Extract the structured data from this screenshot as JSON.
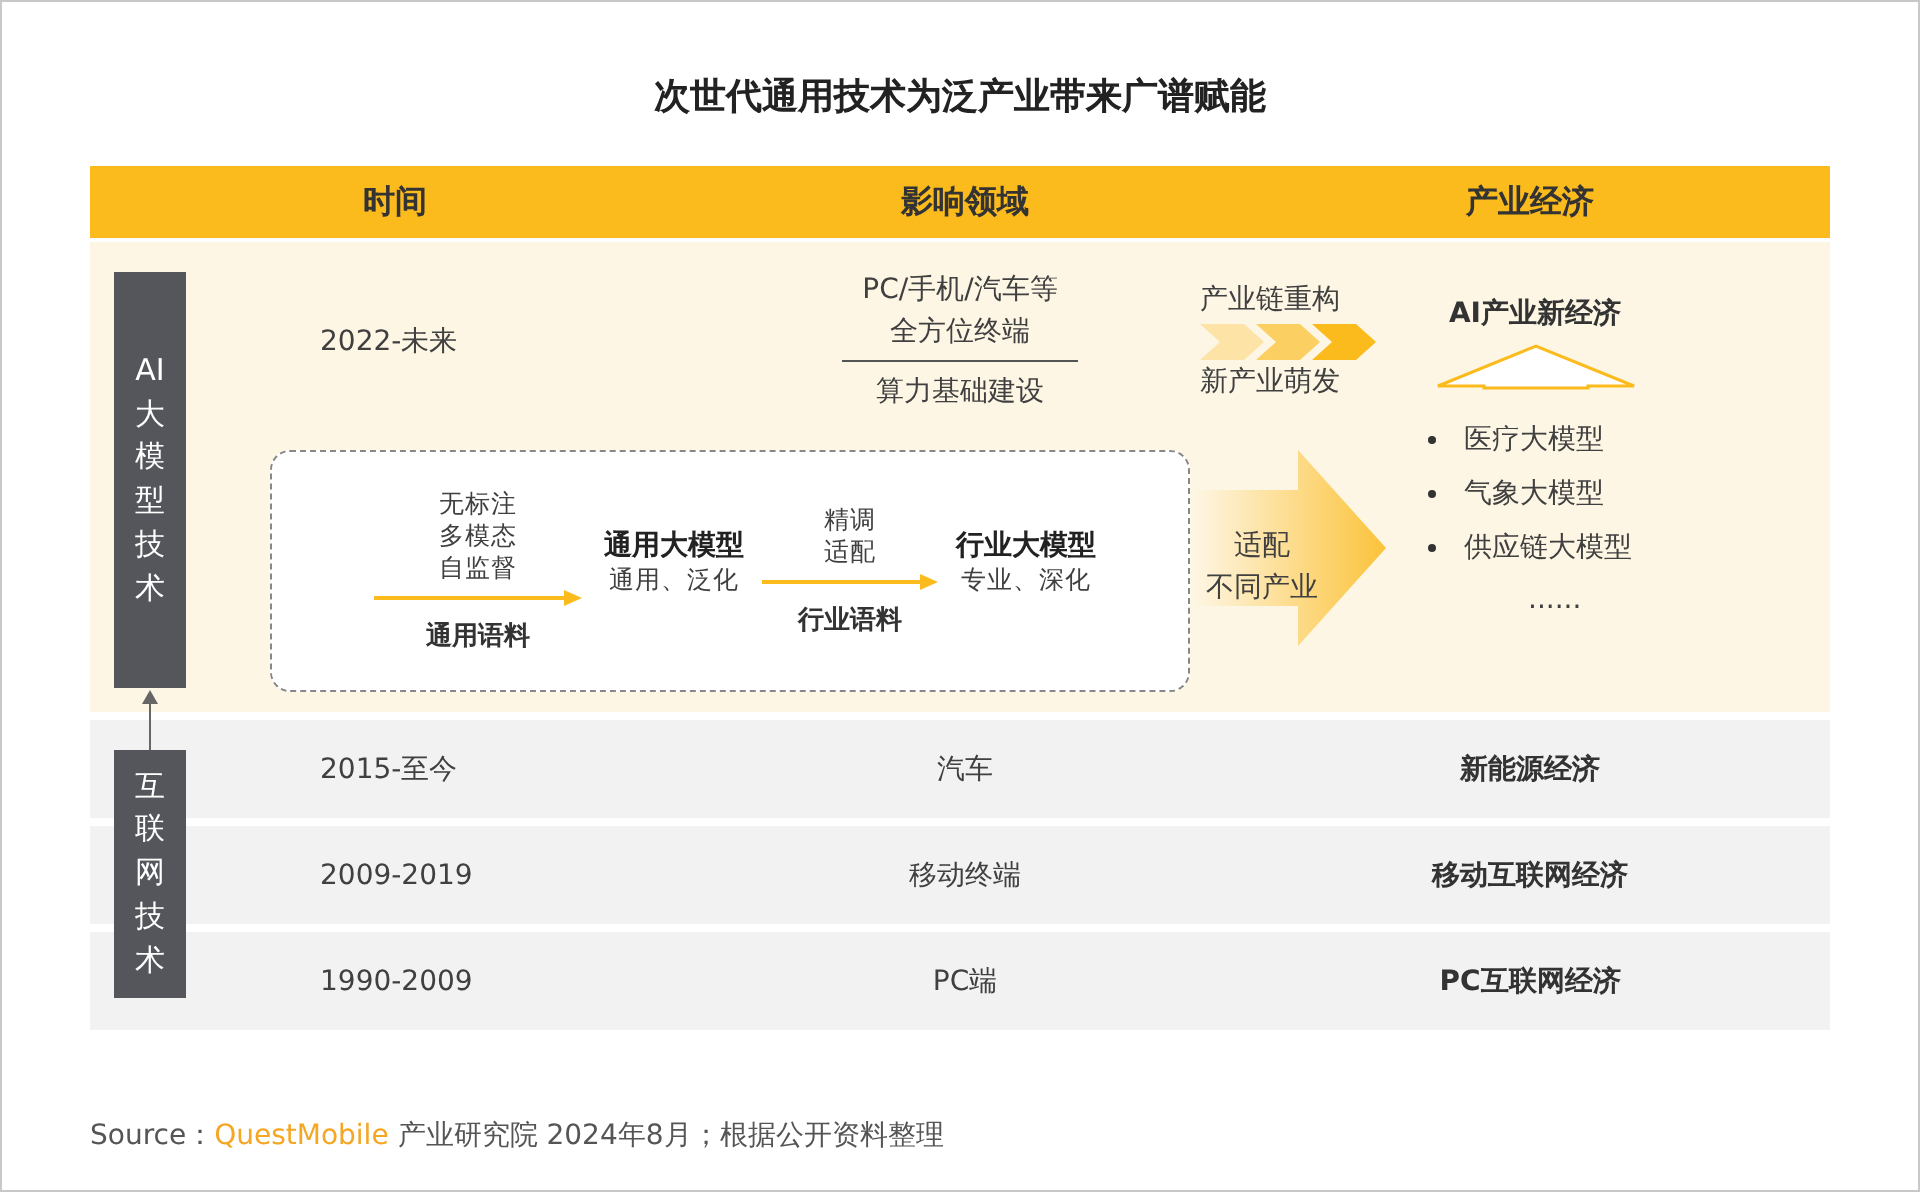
{
  "title": "次世代通用技术为泛产业带来广谱赋能",
  "header": [
    "时间",
    "影响领域",
    "产业经济"
  ],
  "ai_era": {
    "label": "AI大模型技术",
    "period": "2022-未来",
    "fields": [
      "PC/手机/汽车等",
      "全方位终端"
    ],
    "infrastructure": "算力基础建设",
    "chain_top": "产业链重构",
    "chain_bottom": "新产业萌发",
    "economy": "AI产业新经济",
    "flow": [
      {
        "kind": "arrow",
        "above": [
          "无标注",
          "多模态",
          "自监督"
        ],
        "below": "通用语料"
      },
      {
        "kind": "model",
        "title": "通用大模型",
        "subtitle": "通用、泛化"
      },
      {
        "kind": "arrow",
        "above": [
          "精调",
          "适配"
        ],
        "below": "行业语料"
      },
      {
        "kind": "model",
        "title": "行业大模型",
        "subtitle": "专业、深化"
      }
    ],
    "adapt": [
      "适配",
      "不同产业"
    ],
    "models": [
      {
        "kind": "bullet",
        "text": "医疗大模型"
      },
      {
        "kind": "bullet",
        "text": "气象大模型"
      },
      {
        "kind": "bullet",
        "text": "供应链大模型"
      },
      {
        "kind": "ellipsis",
        "text": "......"
      }
    ]
  },
  "internet_era": {
    "label": "互联网技术",
    "rows": [
      {
        "period": "2015-至今",
        "field": "汽车",
        "economy": "新能源经济"
      },
      {
        "period": "2009-2019",
        "field": "移动终端",
        "economy": "移动互联网经济"
      },
      {
        "period": "1990-2009",
        "field": "PC端",
        "economy": "PC互联网经济"
      }
    ]
  },
  "source": {
    "prefix": "Source：",
    "brand": "QuestMobile",
    "text": "产业研究院 2024年8月；根据公开资料整理"
  }
}
